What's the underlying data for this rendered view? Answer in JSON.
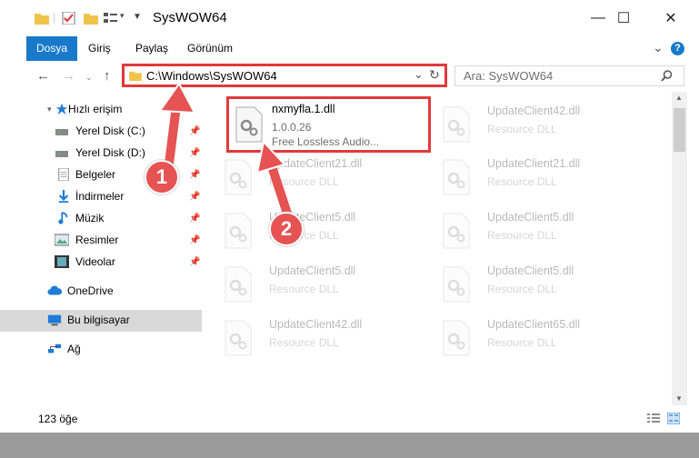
{
  "window": {
    "title": "SysWOW64",
    "minimize": "—",
    "maximize": "☐",
    "close": "✕"
  },
  "ribbon": {
    "tabs": [
      "Dosya",
      "Giriş",
      "Paylaş",
      "Görünüm"
    ],
    "expand": "⌄",
    "help": "?"
  },
  "address": {
    "path": "C:\\Windows\\SysWOW64",
    "search_placeholder": "Ara: SysWOW64"
  },
  "sidebar": {
    "items": [
      {
        "label": "Hızlı erişim",
        "icon": "star-icon"
      },
      {
        "label": "Yerel Disk (C:)",
        "icon": "drive-icon"
      },
      {
        "label": "Yerel Disk (D:)",
        "icon": "drive-icon"
      },
      {
        "label": "Belgeler",
        "icon": "documents-icon"
      },
      {
        "label": "İndirmeler",
        "icon": "download-icon"
      },
      {
        "label": "Müzik",
        "icon": "music-icon"
      },
      {
        "label": "Resimler",
        "icon": "pictures-icon"
      },
      {
        "label": "Videolar",
        "icon": "video-icon"
      },
      {
        "label": "OneDrive",
        "icon": "cloud-icon"
      },
      {
        "label": "Bu bilgisayar",
        "icon": "computer-icon"
      },
      {
        "label": "Ağ",
        "icon": "network-icon"
      }
    ]
  },
  "files": [
    {
      "name": "nxmyfla.1.dll",
      "line1": "1.0.0.26",
      "line2": "Free Lossless Audio..."
    },
    {
      "name": "UpdateClient42.dll",
      "line1": "Resource DLL"
    },
    {
      "name": "UpdateClient21.dll",
      "line1": "Resource DLL"
    },
    {
      "name": "UpdateClient21.dll",
      "line1": "Resource DLL"
    },
    {
      "name": "UpdateClient5.dll",
      "line1": "Resource DLL"
    },
    {
      "name": "UpdateClient5.dll",
      "line1": "Resource DLL"
    },
    {
      "name": "UpdateClient5.dll",
      "line1": "Resource DLL"
    },
    {
      "name": "UpdateClient5.dll",
      "line1": "Resource DLL"
    },
    {
      "name": "UpdateClient42.dll",
      "line1": "Resource DLL"
    },
    {
      "name": "UpdateClient65.dll",
      "line1": "Resource DLL"
    }
  ],
  "status": {
    "count": "123 öğe"
  },
  "markers": [
    "1",
    "2"
  ],
  "colors": {
    "accent": "#1979ca",
    "highlight": "#e03a3a",
    "marker": "#e65353"
  }
}
